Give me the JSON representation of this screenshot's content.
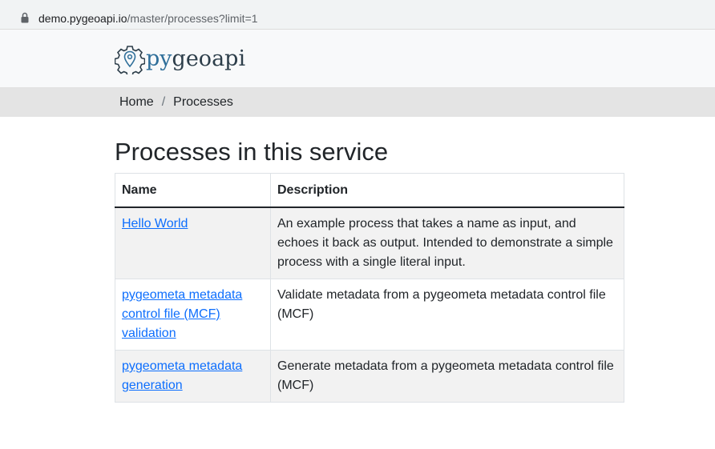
{
  "browser": {
    "url_host": "demo.pygeoapi.io",
    "url_path": "/master/processes?limit=1"
  },
  "header": {
    "logo_prefix": "py",
    "logo_suffix": "geoapi"
  },
  "breadcrumb": {
    "home": "Home",
    "separator": "/",
    "current": "Processes"
  },
  "page": {
    "title": "Processes in this service"
  },
  "table": {
    "headers": {
      "name": "Name",
      "description": "Description"
    },
    "rows": [
      {
        "name": "Hello World",
        "description": "An example process that takes a name as input, and echoes it back as output. Intended to demonstrate a simple process with a single literal input."
      },
      {
        "name": "pygeometa metadata control file (MCF) validation",
        "description": "Validate metadata from a pygeometa metadata control file (MCF)"
      },
      {
        "name": "pygeometa metadata generation",
        "description": "Generate metadata from a pygeometa metadata control file (MCF)"
      }
    ]
  },
  "colors": {
    "link": "#0d6efd",
    "breadcrumb_bg": "#e4e4e4",
    "header_bg": "#f8f9fa",
    "stripe_bg": "#f2f2f2"
  }
}
